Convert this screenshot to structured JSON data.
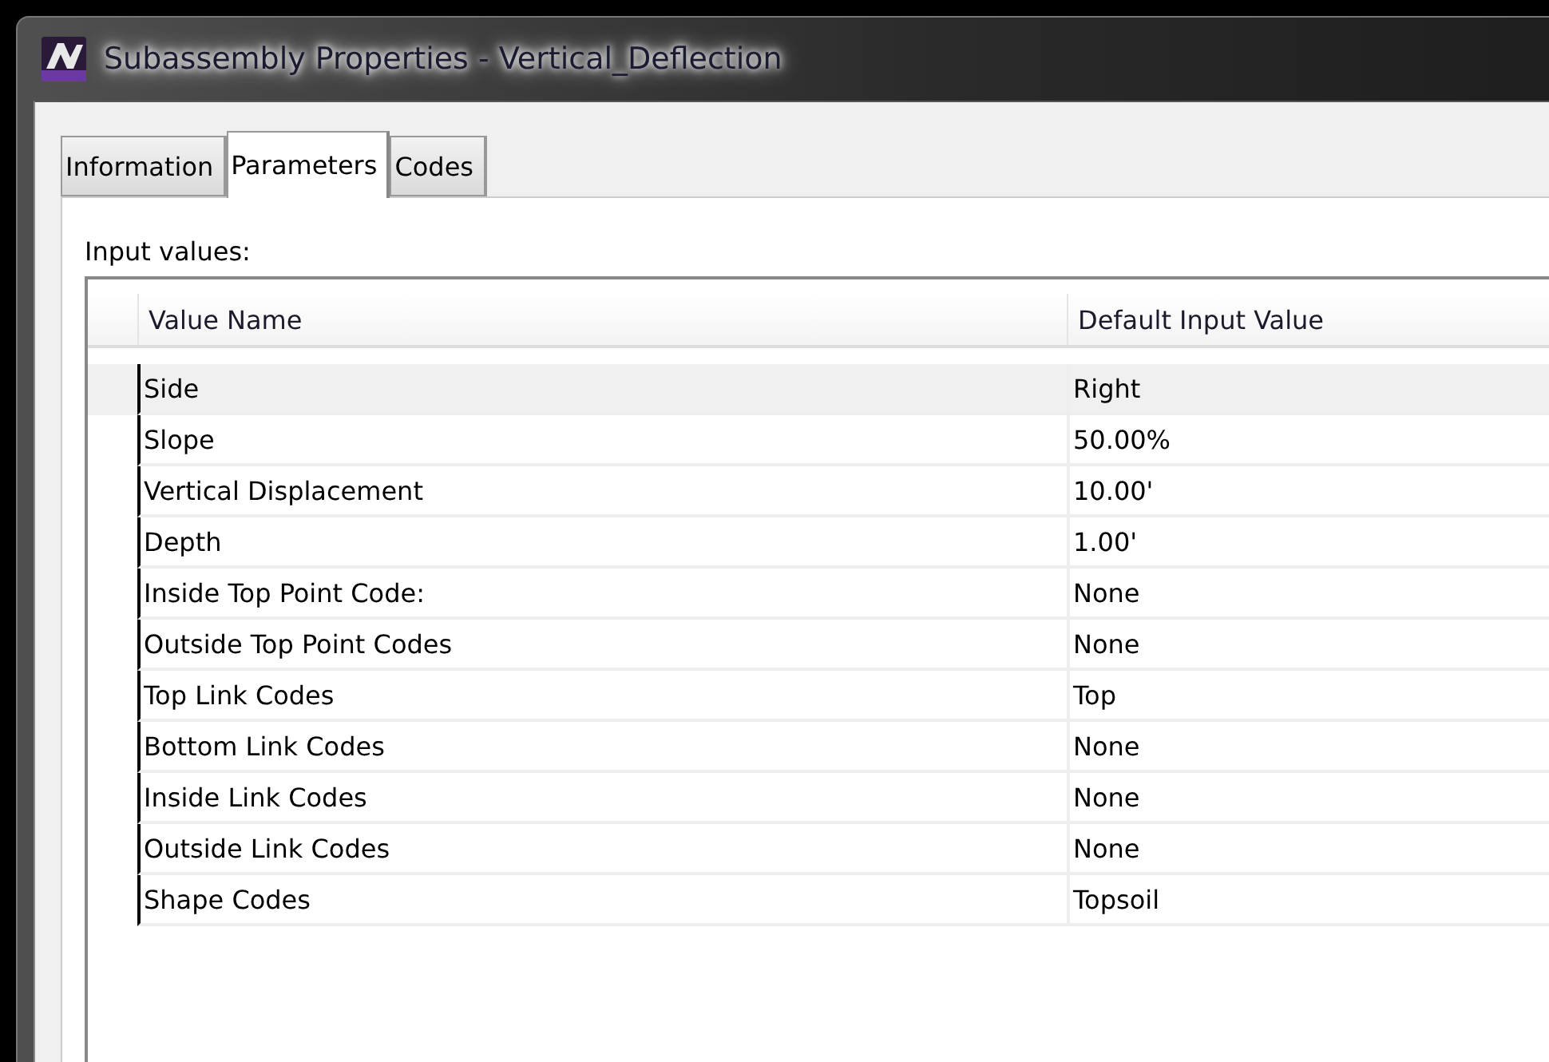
{
  "window": {
    "title": "Subassembly Properties - Vertical_Deflection"
  },
  "tabs": [
    {
      "label": "Information",
      "selected": false
    },
    {
      "label": "Parameters",
      "selected": true
    },
    {
      "label": "Codes",
      "selected": false
    }
  ],
  "section_label": "Input values:",
  "table": {
    "columns": [
      "Value Name",
      "Default Input Value"
    ],
    "rows": [
      {
        "name": "Side",
        "value": "Right",
        "selected": true
      },
      {
        "name": "Slope",
        "value": "50.00%",
        "selected": false
      },
      {
        "name": "Vertical Displacement",
        "value": "10.00'",
        "selected": false
      },
      {
        "name": "Depth",
        "value": "1.00'",
        "selected": false
      },
      {
        "name": "Inside Top Point Code:",
        "value": "None",
        "selected": false
      },
      {
        "name": "Outside Top Point Codes",
        "value": "None",
        "selected": false
      },
      {
        "name": "Top Link Codes",
        "value": "Top",
        "selected": false
      },
      {
        "name": "Bottom Link Codes",
        "value": "None",
        "selected": false
      },
      {
        "name": "Inside Link Codes",
        "value": "None",
        "selected": false
      },
      {
        "name": "Outside Link Codes",
        "value": "None",
        "selected": false
      },
      {
        "name": "Shape Codes",
        "value": "Topsoil",
        "selected": false
      }
    ]
  }
}
